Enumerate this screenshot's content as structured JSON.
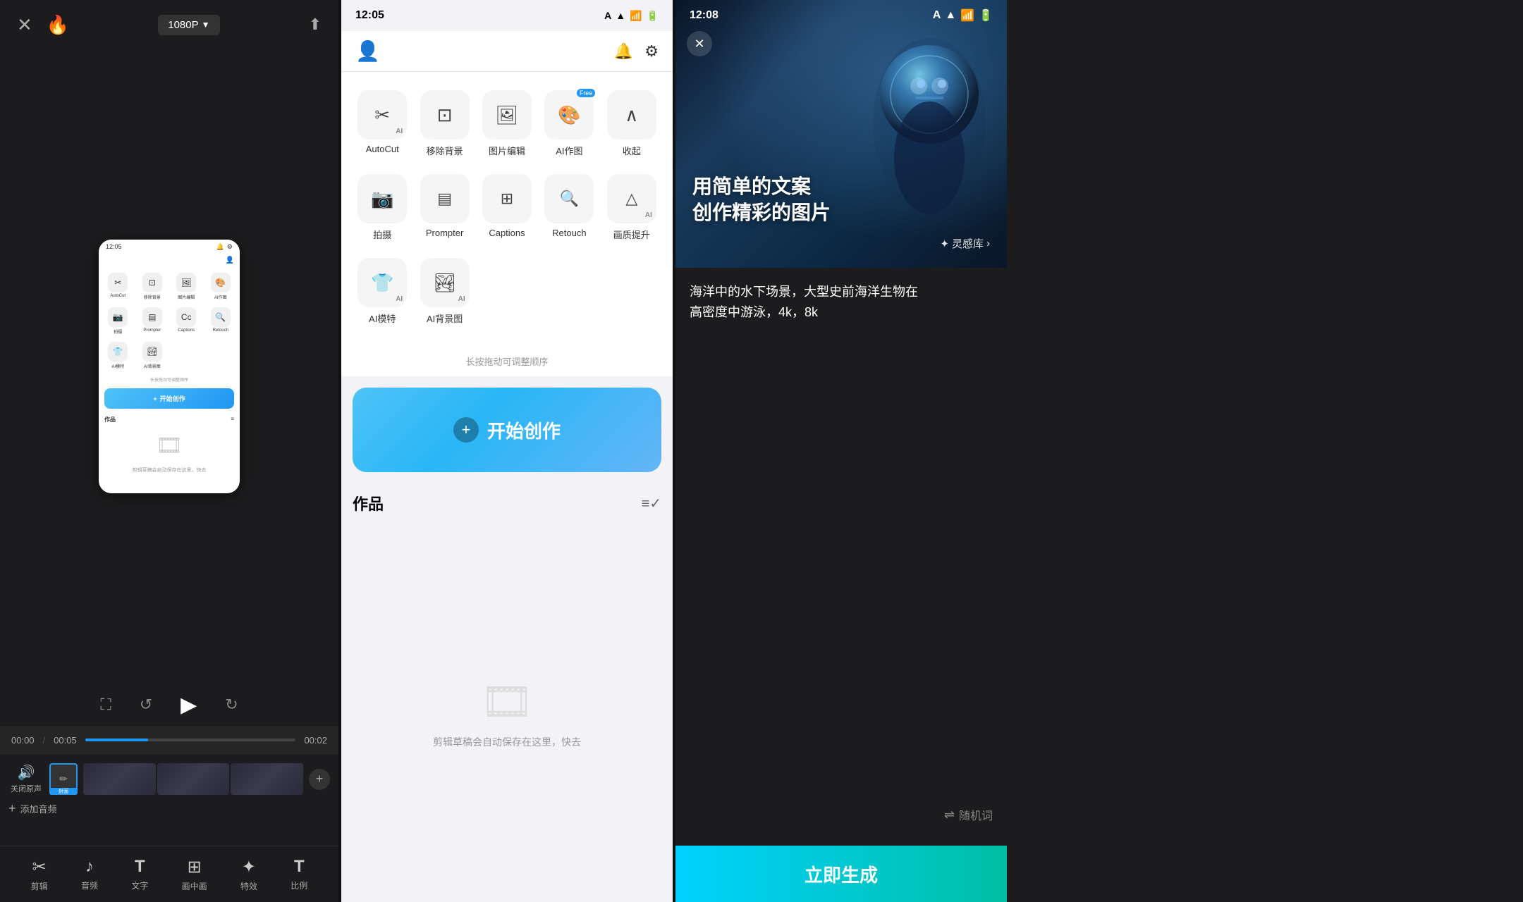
{
  "panel_left": {
    "resolution": "1080P",
    "time_current": "00:00",
    "time_total": "00:05",
    "time_marker": "00:02",
    "track_label_close": "关闭原声",
    "track_label_cover": "封面",
    "add_audio_label": "添加音频",
    "tools": [
      {
        "id": "cut",
        "icon": "✂",
        "label": "剪辑"
      },
      {
        "id": "audio",
        "icon": "♪",
        "label": "音频"
      },
      {
        "id": "text",
        "icon": "T",
        "label": "文字"
      },
      {
        "id": "pip",
        "icon": "⊞",
        "label": "画中画"
      },
      {
        "id": "effects",
        "icon": "✦",
        "label": "特效"
      },
      {
        "id": "ratio",
        "icon": "T",
        "label": "比例"
      }
    ]
  },
  "panel_center": {
    "status_time": "12:05",
    "status_indicator": "A",
    "features_row1": [
      {
        "id": "autocut",
        "icon": "✂",
        "label": "AutoCut",
        "badge": null
      },
      {
        "id": "remove_bg",
        "icon": "⊡",
        "label": "移除背景",
        "badge": null
      },
      {
        "id": "img_edit",
        "icon": "🖼",
        "label": "图片编辑",
        "badge": null
      },
      {
        "id": "ai_art",
        "icon": "🎨",
        "label": "AI作图",
        "badge": "Free"
      },
      {
        "id": "collapse",
        "icon": "∧",
        "label": "收起",
        "badge": null
      }
    ],
    "features_row2": [
      {
        "id": "camera",
        "icon": "📷",
        "label": "拍摄",
        "badge": null
      },
      {
        "id": "prompter",
        "icon": "▤",
        "label": "Prompter",
        "badge": null
      },
      {
        "id": "captions",
        "icon": "⊞",
        "label": "Captions",
        "badge": null
      },
      {
        "id": "retouch",
        "icon": "🔍",
        "label": "Retouch",
        "badge": null
      },
      {
        "id": "enhance",
        "icon": "△",
        "label": "画质提升",
        "badge": null
      }
    ],
    "features_row3": [
      {
        "id": "ai_model",
        "icon": "👕",
        "label": "AI模特",
        "badge": null
      },
      {
        "id": "ai_bg",
        "icon": "🏞",
        "label": "AI背景图",
        "badge": null
      }
    ],
    "drag_hint": "长按拖动可调整顺序",
    "start_create_label": "开始创作",
    "works_title": "作品",
    "works_hint_line1": "剪辑草稿会自动保存在这里，快去",
    "phone_status_time": "12:05",
    "phone_start_btn": "开始创作",
    "phone_works": "作品"
  },
  "panel_right": {
    "status_time": "12:08",
    "status_indicator": "A",
    "hero_title": "用简单的文案\n创作精彩的图片",
    "inspiration_label": "✦ 灵感库",
    "prompt_text": "海洋中的水下场景，大型史前海洋生物在\n高密度中游泳，4k，8k",
    "random_word_label": "随机词",
    "generate_label": "立即生成"
  }
}
